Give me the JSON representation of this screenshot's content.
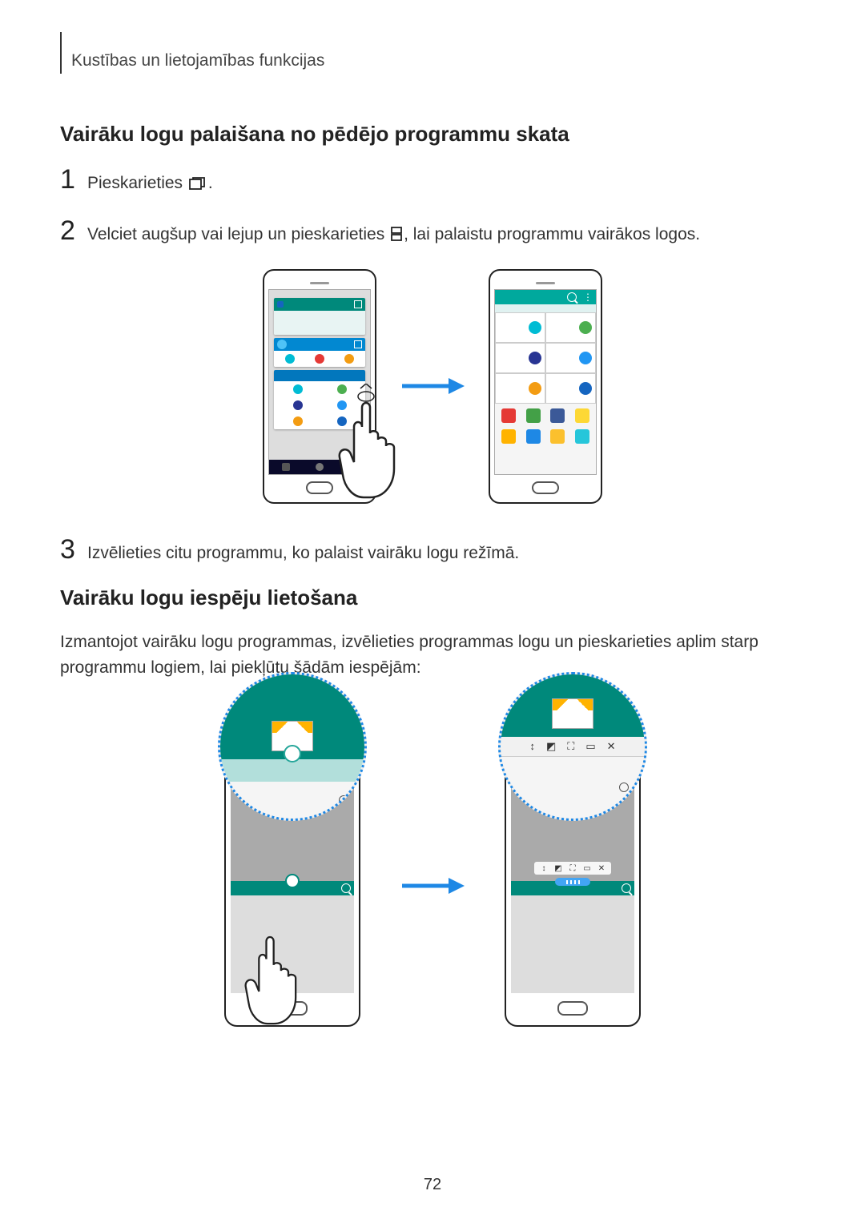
{
  "breadcrumb": "Kustības un lietojamības funkcijas",
  "section1_title": "Vairāku logu palaišana no pēdējo programmu skata",
  "step1_prefix": "Pieskarieties ",
  "step1_suffix": ".",
  "step2_prefix": "Velciet augšup vai lejup un pieskarieties ",
  "step2_suffix": ", lai palaistu programmu vairākos logos.",
  "step3_text": "Izvēlieties citu programmu, ko palaist vairāku logu režīmā.",
  "section2_title": "Vairāku logu iespēju lietošana",
  "section2_body": "Izmantojot vairāku logu programmas, izvēlieties programmas logu un pieskarieties aplim starp programmu logiem, lai piekļūtu šādām iespējām:",
  "page_number": "72",
  "nums": {
    "one": "1",
    "two": "2",
    "three": "3"
  }
}
